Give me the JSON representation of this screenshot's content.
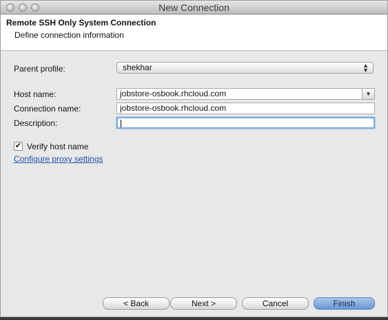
{
  "window": {
    "title": "New Connection"
  },
  "banner": {
    "title": "Remote SSH Only System Connection",
    "subtitle": "Define connection information"
  },
  "form": {
    "parent_profile": {
      "label": "Parent profile:",
      "value": "shekhar"
    },
    "host_name": {
      "label": "Host name:",
      "value": "jobstore-osbook.rhcloud.com"
    },
    "connection_name": {
      "label": "Connection name:",
      "value": "jobstore-osbook.rhcloud.com"
    },
    "description": {
      "label": "Description:",
      "value": ""
    },
    "verify_host": {
      "label": "Verify host name",
      "checked": true
    },
    "proxy_link": "Configure proxy settings"
  },
  "buttons": {
    "back": "< Back",
    "next": "Next >",
    "cancel": "Cancel",
    "finish": "Finish"
  },
  "icons": {
    "checkmark": "✔",
    "dropdown": "▼",
    "updown_up": "▲",
    "updown_down": "▼"
  }
}
